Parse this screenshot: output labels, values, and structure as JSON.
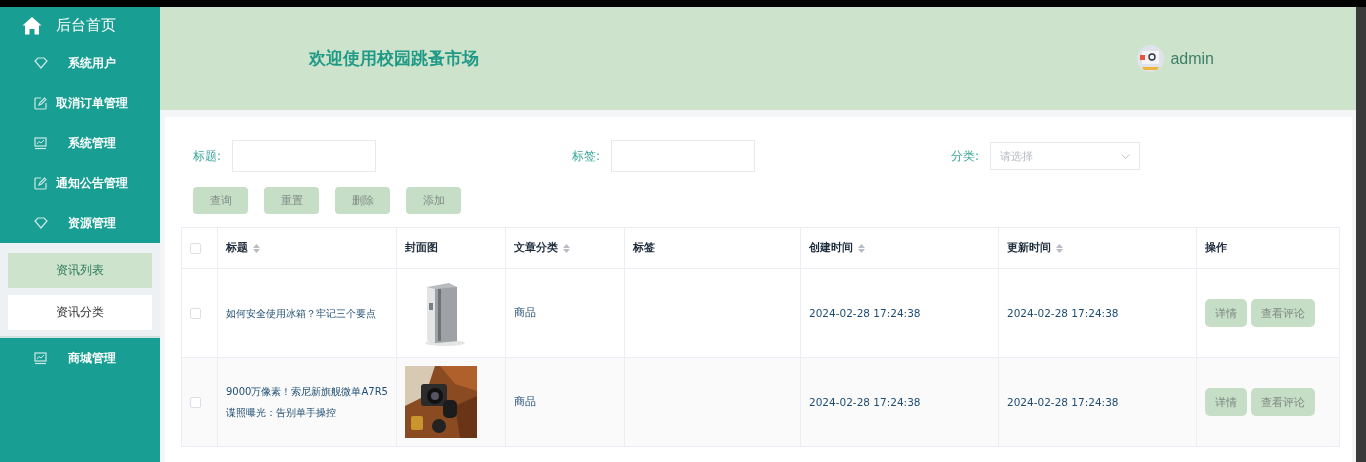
{
  "sidebar": {
    "home": {
      "label": "后台首页"
    },
    "items": [
      {
        "label": "系统用户",
        "kind": "diamond"
      },
      {
        "label": "取消订单管理",
        "kind": "edit"
      },
      {
        "label": "系统管理",
        "kind": "chart"
      },
      {
        "label": "通知公告管理",
        "kind": "edit"
      },
      {
        "label": "资源管理",
        "kind": "diamond",
        "expanded": true,
        "children": [
          {
            "label": "资讯列表",
            "selected": true
          },
          {
            "label": "资讯分类",
            "selected": false
          }
        ]
      },
      {
        "label": "商城管理",
        "kind": "chart"
      }
    ]
  },
  "header": {
    "title": "欢迎使用校园跳蚤市场",
    "user": "admin"
  },
  "filters": [
    {
      "label": "标题:",
      "kind": "text"
    },
    {
      "label": "标签:",
      "kind": "text"
    },
    {
      "label": "分类:",
      "kind": "select",
      "placeholder": "请选择"
    }
  ],
  "buttons": [
    "查询",
    "重置",
    "删除",
    "添加"
  ],
  "table": {
    "header_checked": false,
    "columns": [
      {
        "label": "标题",
        "sortable": true
      },
      {
        "label": "封面图",
        "sortable": false
      },
      {
        "label": "文章分类",
        "sortable": true
      },
      {
        "label": "标签",
        "sortable": false
      },
      {
        "label": "创建时间",
        "sortable": true
      },
      {
        "label": "更新时间",
        "sortable": true
      },
      {
        "label": "操作",
        "sortable": false
      }
    ],
    "rows": [
      {
        "checked": false,
        "title": "如何安全使用冰箱？牢记三个要点",
        "cover": {
          "kind": "picture"
        },
        "category": "商品",
        "created": "2024-02-28 17:24:38",
        "updated": "2024-02-28 17:24:38",
        "actions": [
          "详情",
          "查看评论"
        ]
      },
      {
        "checked": false,
        "title": "9000万像素！索尼新旗舰微单A7R5谍照曝光：告别单手操控",
        "cover": {
          "kind": "picture"
        },
        "category": "商品",
        "created": "2024-02-28 17:24:38",
        "updated": "2024-02-28 17:24:38",
        "actions": [
          "详情",
          "查看评论"
        ]
      }
    ]
  }
}
